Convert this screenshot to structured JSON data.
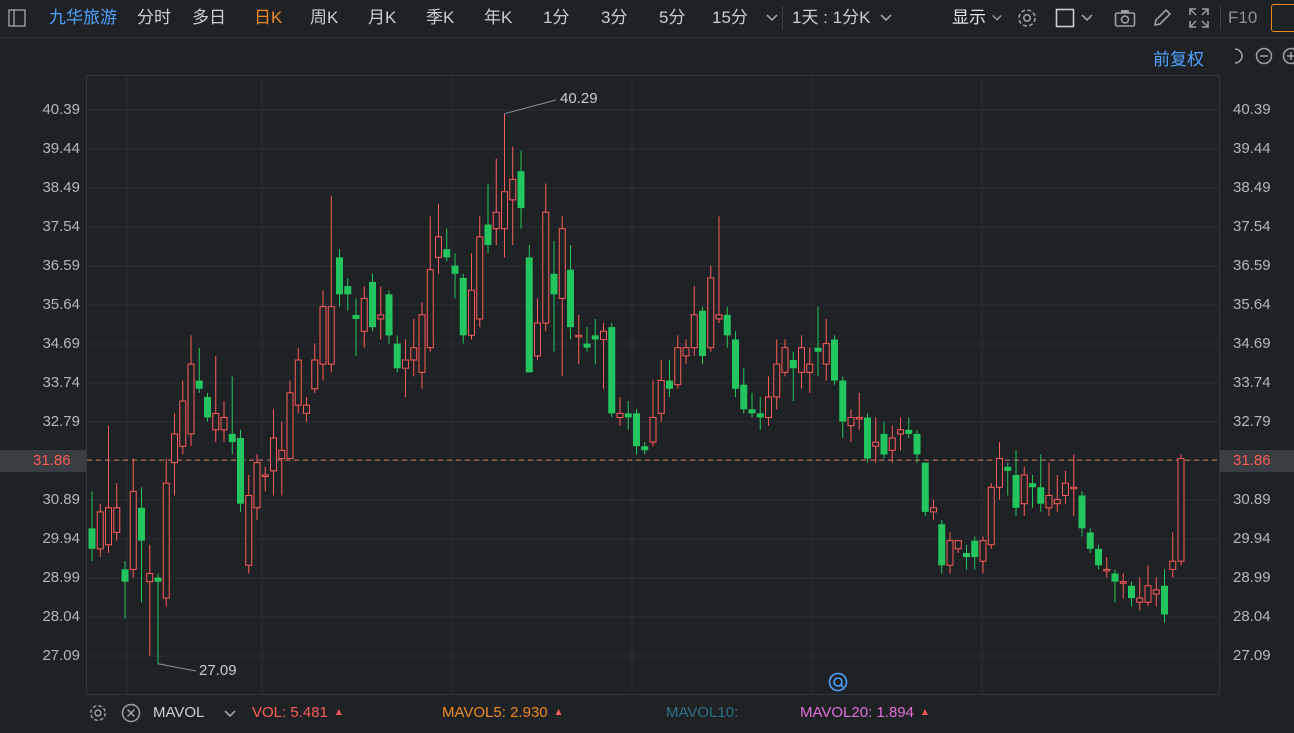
{
  "toolbar": {
    "stock_name": "九华旅游",
    "periods": [
      "分时",
      "多日",
      "日K",
      "周K",
      "月K",
      "季K",
      "年K",
      "1分",
      "3分",
      "5分",
      "15分"
    ],
    "active_period": "日K",
    "range_select": "1天 : 1分K",
    "display_label": "显示",
    "f10_label": "F10"
  },
  "chart_header": {
    "adjust_label": "前复权"
  },
  "price_axis": {
    "labels": [
      "40.39",
      "39.44",
      "38.49",
      "37.54",
      "36.59",
      "35.64",
      "34.69",
      "33.74",
      "32.79",
      "31.86",
      "30.89",
      "29.94",
      "28.99",
      "28.04",
      "27.09"
    ],
    "current_price": "31.86"
  },
  "annotations": {
    "high_label": "40.29",
    "low_label": "27.09"
  },
  "volume": {
    "indicator": "MAVOL",
    "vol_label": "VOL:",
    "vol_value": "5.481",
    "mavol5_label": "MAVOL5:",
    "mavol5_value": "2.930",
    "mavol10_label": "MAVOL10:",
    "mavol20_label": "MAVOL20:",
    "mavol20_value": "1.894"
  },
  "colors": {
    "up": "#ff5b5b",
    "down": "#22c55e",
    "accent": "#f08a1c",
    "link": "#4ea1ff"
  },
  "chart_data": {
    "type": "candlestick",
    "y_range": [
      27.09,
      40.39
    ],
    "candles": [
      [
        30.2,
        29.7,
        31.1,
        29.4
      ],
      [
        29.7,
        30.6,
        30.8,
        29.5
      ],
      [
        29.8,
        30.7,
        32.7,
        29.6
      ],
      [
        30.1,
        30.7,
        31.3,
        29.9
      ],
      [
        29.2,
        28.9,
        29.4,
        28.0
      ],
      [
        29.2,
        31.1,
        31.9,
        29.0
      ],
      [
        30.7,
        29.9,
        31.2,
        28.4
      ],
      [
        28.9,
        29.1,
        29.8,
        27.1
      ],
      [
        29.0,
        28.9,
        29.1,
        26.9
      ],
      [
        28.5,
        31.3,
        31.9,
        28.3
      ],
      [
        31.8,
        32.5,
        33.0,
        31.0
      ],
      [
        32.2,
        33.3,
        33.8,
        32.0
      ],
      [
        32.5,
        34.2,
        34.9,
        32.2
      ],
      [
        33.8,
        33.6,
        34.6,
        33.5
      ],
      [
        33.4,
        32.9,
        33.5,
        32.8
      ],
      [
        32.6,
        33.0,
        34.4,
        32.3
      ],
      [
        32.6,
        32.9,
        33.3,
        32.3
      ],
      [
        32.5,
        32.3,
        33.9,
        32.0
      ],
      [
        32.4,
        30.8,
        32.6,
        30.6
      ],
      [
        29.3,
        31.0,
        31.5,
        29.1
      ],
      [
        30.7,
        31.8,
        32.0,
        30.4
      ],
      [
        31.5,
        31.5,
        31.7,
        31.1
      ],
      [
        31.6,
        32.4,
        33.1,
        31.0
      ],
      [
        31.9,
        32.1,
        32.8,
        31.0
      ],
      [
        31.9,
        33.5,
        33.8,
        31.9
      ],
      [
        33.2,
        34.3,
        34.6,
        33.0
      ],
      [
        33.0,
        33.2,
        33.4,
        32.8
      ],
      [
        33.6,
        34.3,
        34.7,
        33.5
      ],
      [
        34.2,
        35.6,
        36.0,
        33.8
      ],
      [
        34.2,
        35.6,
        38.3,
        34.0
      ],
      [
        36.8,
        35.9,
        37.0,
        35.6
      ],
      [
        36.1,
        35.9,
        36.3,
        35.5
      ],
      [
        35.4,
        35.3,
        35.8,
        34.4
      ],
      [
        35.0,
        35.8,
        36.1,
        34.6
      ],
      [
        36.2,
        35.1,
        36.4,
        35.0
      ],
      [
        35.3,
        35.4,
        36.1,
        34.8
      ],
      [
        35.9,
        34.9,
        36.0,
        34.7
      ],
      [
        34.7,
        34.1,
        34.9,
        34.0
      ],
      [
        34.1,
        34.3,
        34.8,
        33.4
      ],
      [
        34.3,
        34.6,
        35.3,
        33.9
      ],
      [
        34.0,
        35.4,
        35.7,
        33.6
      ],
      [
        34.6,
        36.5,
        37.8,
        34.5
      ],
      [
        36.8,
        37.3,
        38.1,
        36.4
      ],
      [
        37.0,
        36.8,
        37.5,
        36.7
      ],
      [
        36.6,
        36.4,
        36.9,
        35.8
      ],
      [
        36.3,
        34.9,
        36.4,
        34.7
      ],
      [
        34.9,
        36.0,
        36.9,
        34.8
      ],
      [
        35.3,
        37.3,
        37.8,
        35.1
      ],
      [
        37.6,
        37.1,
        38.6,
        36.9
      ],
      [
        37.5,
        37.9,
        39.2,
        37.1
      ],
      [
        37.5,
        38.4,
        40.3,
        36.8
      ],
      [
        38.2,
        38.7,
        39.5,
        37.1
      ],
      [
        38.9,
        38.0,
        39.4,
        37.5
      ],
      [
        36.8,
        34.0,
        37.1,
        34.0
      ],
      [
        34.4,
        35.2,
        35.8,
        34.3
      ],
      [
        35.2,
        37.9,
        38.6,
        35.0
      ],
      [
        36.4,
        35.9,
        37.2,
        34.5
      ],
      [
        35.8,
        37.5,
        37.8,
        33.9
      ],
      [
        36.5,
        35.1,
        37.1,
        34.8
      ],
      [
        34.9,
        34.9,
        35.4,
        34.2
      ],
      [
        34.7,
        34.6,
        35.1,
        34.5
      ],
      [
        34.9,
        34.8,
        35.3,
        34.2
      ],
      [
        34.8,
        35.0,
        35.2,
        33.6
      ],
      [
        35.1,
        33.0,
        35.2,
        32.9
      ],
      [
        32.9,
        33.0,
        33.4,
        32.7
      ],
      [
        33.0,
        32.9,
        33.3,
        32.6
      ],
      [
        33.0,
        32.2,
        33.1,
        32.0
      ],
      [
        32.2,
        32.1,
        32.3,
        32.0
      ],
      [
        32.3,
        32.9,
        33.8,
        32.2
      ],
      [
        33.0,
        33.8,
        34.3,
        32.8
      ],
      [
        33.8,
        33.6,
        34.3,
        33.4
      ],
      [
        33.7,
        34.6,
        34.9,
        33.6
      ],
      [
        34.4,
        34.6,
        34.8,
        34.2
      ],
      [
        34.6,
        35.4,
        36.1,
        34.4
      ],
      [
        35.5,
        34.4,
        35.6,
        34.2
      ],
      [
        34.6,
        36.3,
        36.6,
        34.5
      ],
      [
        35.3,
        35.4,
        37.8,
        35.2
      ],
      [
        35.4,
        34.9,
        35.6,
        34.6
      ],
      [
        34.8,
        33.6,
        35.0,
        33.4
      ],
      [
        33.7,
        33.1,
        34.1,
        33.0
      ],
      [
        33.1,
        33.0,
        33.5,
        32.9
      ],
      [
        33.0,
        32.9,
        33.4,
        32.6
      ],
      [
        32.9,
        33.4,
        33.9,
        32.7
      ],
      [
        33.4,
        34.2,
        34.8,
        33.1
      ],
      [
        34.0,
        34.6,
        34.8,
        33.9
      ],
      [
        34.3,
        34.1,
        34.5,
        33.3
      ],
      [
        34.0,
        34.6,
        34.9,
        33.6
      ],
      [
        34.0,
        34.2,
        34.6,
        33.5
      ],
      [
        34.6,
        34.5,
        35.6,
        33.9
      ],
      [
        34.2,
        34.7,
        35.3,
        33.8
      ],
      [
        34.8,
        33.8,
        34.9,
        33.7
      ],
      [
        33.8,
        32.8,
        33.9,
        32.4
      ],
      [
        32.7,
        32.9,
        33.1,
        32.3
      ],
      [
        32.9,
        32.9,
        33.5,
        32.6
      ],
      [
        32.9,
        31.9,
        33.0,
        31.8
      ],
      [
        32.2,
        32.3,
        32.9,
        31.8
      ],
      [
        32.5,
        32.0,
        32.8,
        31.9
      ],
      [
        32.1,
        32.4,
        32.7,
        31.8
      ],
      [
        32.5,
        32.6,
        32.9,
        32.1
      ],
      [
        32.6,
        32.5,
        32.9,
        32.4
      ],
      [
        32.5,
        32.0,
        32.6,
        31.8
      ],
      [
        31.8,
        30.6,
        31.8,
        30.5
      ],
      [
        30.6,
        30.7,
        30.9,
        30.4
      ],
      [
        30.3,
        29.3,
        30.4,
        29.1
      ],
      [
        29.3,
        29.9,
        30.1,
        29.1
      ],
      [
        29.7,
        29.9,
        29.9,
        29.6
      ],
      [
        29.6,
        29.5,
        29.8,
        29.2
      ],
      [
        29.9,
        29.5,
        30.0,
        29.2
      ],
      [
        29.4,
        29.9,
        30.0,
        29.1
      ],
      [
        29.8,
        31.2,
        31.3,
        29.7
      ],
      [
        31.2,
        31.9,
        32.3,
        30.9
      ],
      [
        31.7,
        31.6,
        31.8,
        31.0
      ],
      [
        31.5,
        30.7,
        32.1,
        30.5
      ],
      [
        30.8,
        31.5,
        31.7,
        30.5
      ],
      [
        31.3,
        31.2,
        31.5,
        30.7
      ],
      [
        31.2,
        30.8,
        32.0,
        30.6
      ],
      [
        30.7,
        31.0,
        31.8,
        30.5
      ],
      [
        30.8,
        30.9,
        31.5,
        30.6
      ],
      [
        31.0,
        31.3,
        31.6,
        30.8
      ],
      [
        31.2,
        31.2,
        32.0,
        30.5
      ],
      [
        31.0,
        30.2,
        31.1,
        30.0
      ],
      [
        30.1,
        29.7,
        30.2,
        29.6
      ],
      [
        29.7,
        29.3,
        29.8,
        29.2
      ],
      [
        29.2,
        29.2,
        29.5,
        29.0
      ],
      [
        29.1,
        28.9,
        29.2,
        28.4
      ],
      [
        28.9,
        28.9,
        29.1,
        28.5
      ],
      [
        28.8,
        28.5,
        28.9,
        28.3
      ],
      [
        28.4,
        28.5,
        29.0,
        28.2
      ],
      [
        28.4,
        28.8,
        29.3,
        28.3
      ],
      [
        28.6,
        28.7,
        29.0,
        28.3
      ],
      [
        28.8,
        28.1,
        29.2,
        27.9
      ],
      [
        29.2,
        29.4,
        30.1,
        29.0
      ],
      [
        29.4,
        31.9,
        32.0,
        29.3
      ]
    ]
  }
}
